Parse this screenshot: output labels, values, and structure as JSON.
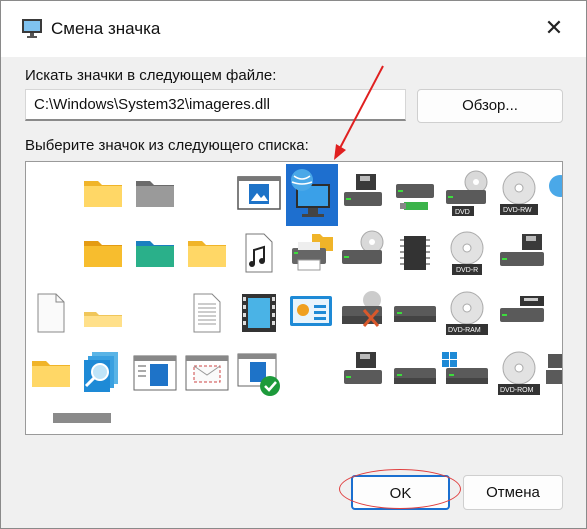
{
  "window": {
    "title": "Смена значка",
    "close_glyph": "✕"
  },
  "search": {
    "label": "Искать значки в следующем файле:",
    "value": "C:\\Windows\\System32\\imageres.dll",
    "browse_label": "Обзор..."
  },
  "list": {
    "label": "Выберите значок из следующего списка:"
  },
  "buttons": {
    "ok": "OK",
    "cancel": "Отмена"
  },
  "drive_labels": {
    "dvd": "DVD",
    "dvd_rw": "DVD-RW",
    "dvd_r": "DVD-R",
    "dvd_ram": "DVD-RAM",
    "dvd_rom": "DVD-ROM"
  },
  "icons": [
    {
      "name": "blank-icon"
    },
    {
      "name": "folder-yellow-icon"
    },
    {
      "name": "folder-gray-icon"
    },
    {
      "name": "blank-icon"
    },
    {
      "name": "picture-window-icon"
    },
    {
      "name": "globe-monitor-icon",
      "selected": true
    },
    {
      "name": "floppy-drive-icon"
    },
    {
      "name": "usb-drive-icon"
    },
    {
      "name": "dvd-drive-icon"
    },
    {
      "name": "dvd-rw-icon"
    },
    {
      "name": "globe-partial-icon"
    },
    {
      "name": "blank-icon"
    },
    {
      "name": "folder-orange-icon"
    },
    {
      "name": "folder-green-icon"
    },
    {
      "name": "folder-yellow-icon"
    },
    {
      "name": "music-file-icon"
    },
    {
      "name": "printer-folder-icon"
    },
    {
      "name": "cd-drive-icon"
    },
    {
      "name": "chip-icon"
    },
    {
      "name": "dvd-r-icon"
    },
    {
      "name": "floppy-partial-icon"
    },
    {
      "name": "blank-icon"
    },
    {
      "name": "blank-file-icon"
    },
    {
      "name": "folder-empty-icon"
    },
    {
      "name": "text-file-icon"
    },
    {
      "name": "video-file-icon"
    },
    {
      "name": "presentation-icon"
    },
    {
      "name": "drive-error-icon"
    },
    {
      "name": "drive-icon"
    },
    {
      "name": "dvd-ram-icon"
    },
    {
      "name": "tape-drive-icon"
    },
    {
      "name": "blank-icon"
    },
    {
      "name": "blank-icon"
    },
    {
      "name": "folder-yellow-icon"
    },
    {
      "name": "search-pages-icon"
    },
    {
      "name": "window-app-icon"
    },
    {
      "name": "mail-window-icon"
    },
    {
      "name": "checked-window-icon"
    },
    {
      "name": "floppy-drive-icon"
    },
    {
      "name": "drive-icon"
    },
    {
      "name": "windows-drive-icon"
    },
    {
      "name": "dvd-rom-icon"
    },
    {
      "name": "removable-drive-icon"
    }
  ]
}
